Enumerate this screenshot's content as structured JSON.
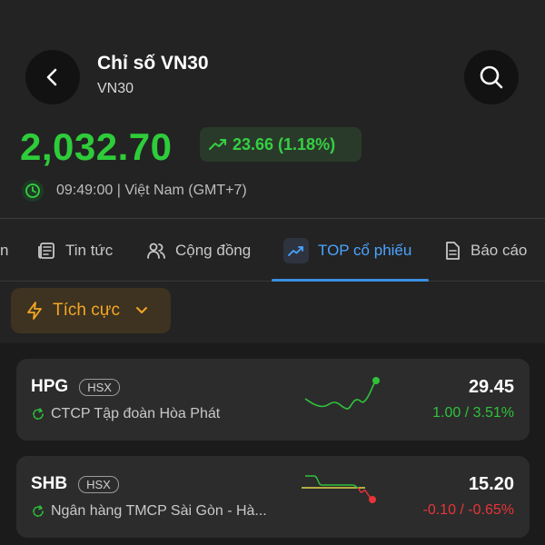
{
  "header": {
    "title": "Chỉ số VN30",
    "subtitle": "VN30",
    "back_icon": "chevron-left-icon",
    "search_icon": "search-icon"
  },
  "quote": {
    "price": "2,032.70",
    "change": "23.66 (1.18%)",
    "time": "09:49:00 | Việt Nam (GMT+7)",
    "colors": {
      "up": "#2ecc3a",
      "down": "#e8343a"
    }
  },
  "tabs": [
    {
      "label": "n",
      "icon": ""
    },
    {
      "label": "Tin tức",
      "icon": "news-icon"
    },
    {
      "label": "Cộng đồng",
      "icon": "people-icon"
    },
    {
      "label": "TOP cổ phiếu",
      "icon": "trending-up-icon",
      "active": true
    },
    {
      "label": "Báo cáo",
      "icon": "document-icon"
    }
  ],
  "filter": {
    "label": "Tích cực",
    "icon": "lightning-icon"
  },
  "stocks": [
    {
      "symbol": "HPG",
      "exchange": "HSX",
      "name": "CTCP Tập đoàn Hòa Phát",
      "price": "29.45",
      "change": "1.00 / 3.51%",
      "direction": "up"
    },
    {
      "symbol": "SHB",
      "exchange": "HSX",
      "name": "Ngân hàng TMCP Sài Gòn - Hà...",
      "price": "15.20",
      "change": "-0.10 / -0.65%",
      "direction": "down"
    }
  ]
}
